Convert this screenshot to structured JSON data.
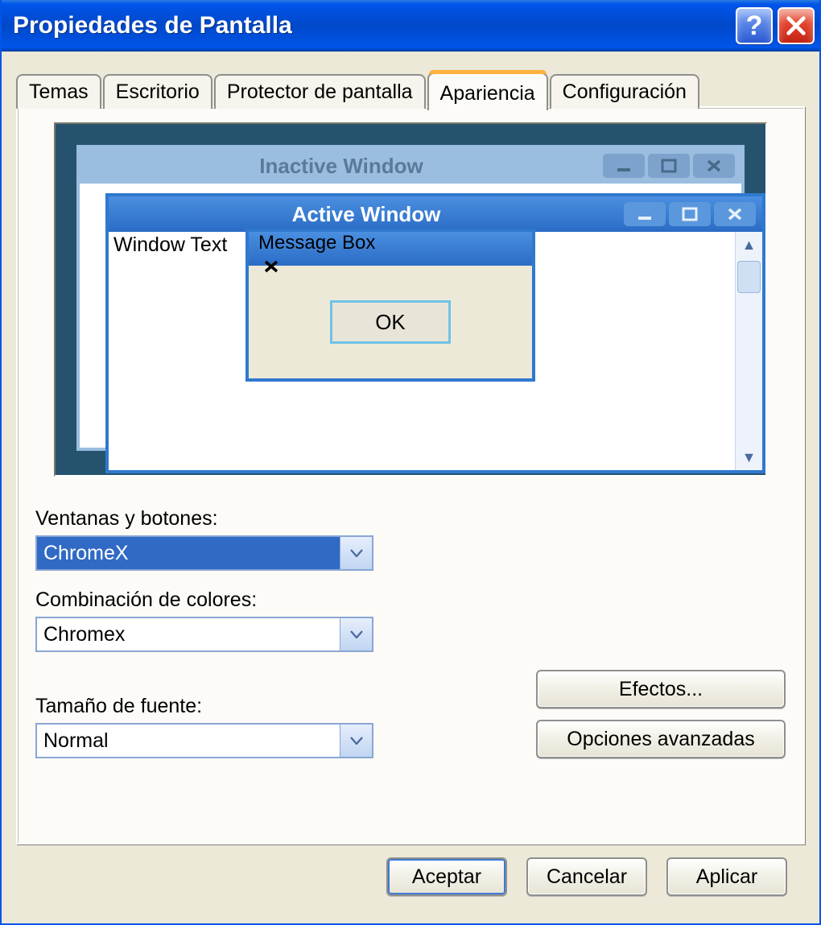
{
  "titlebar": {
    "title": "Propiedades de Pantalla"
  },
  "tabs": {
    "t0": "Temas",
    "t1": "Escritorio",
    "t2": "Protector de pantalla",
    "t3": "Apariencia",
    "t4": "Configuración"
  },
  "preview": {
    "inactive_title": "Inactive Window",
    "active_title": "Active Window",
    "window_text": "Window Text",
    "msgbox_title": "Message Box",
    "msgbox_ok": "OK"
  },
  "form": {
    "windows_label": "Ventanas y botones:",
    "windows_value": "ChromeX",
    "colors_label": "Combinación de colores:",
    "colors_value": "Chromex",
    "font_label": "Tamaño de fuente:",
    "font_value": "Normal",
    "effects_btn": "Efectos...",
    "advanced_btn": "Opciones avanzadas"
  },
  "bottom": {
    "ok": "Aceptar",
    "cancel": "Cancelar",
    "apply": "Aplicar"
  }
}
